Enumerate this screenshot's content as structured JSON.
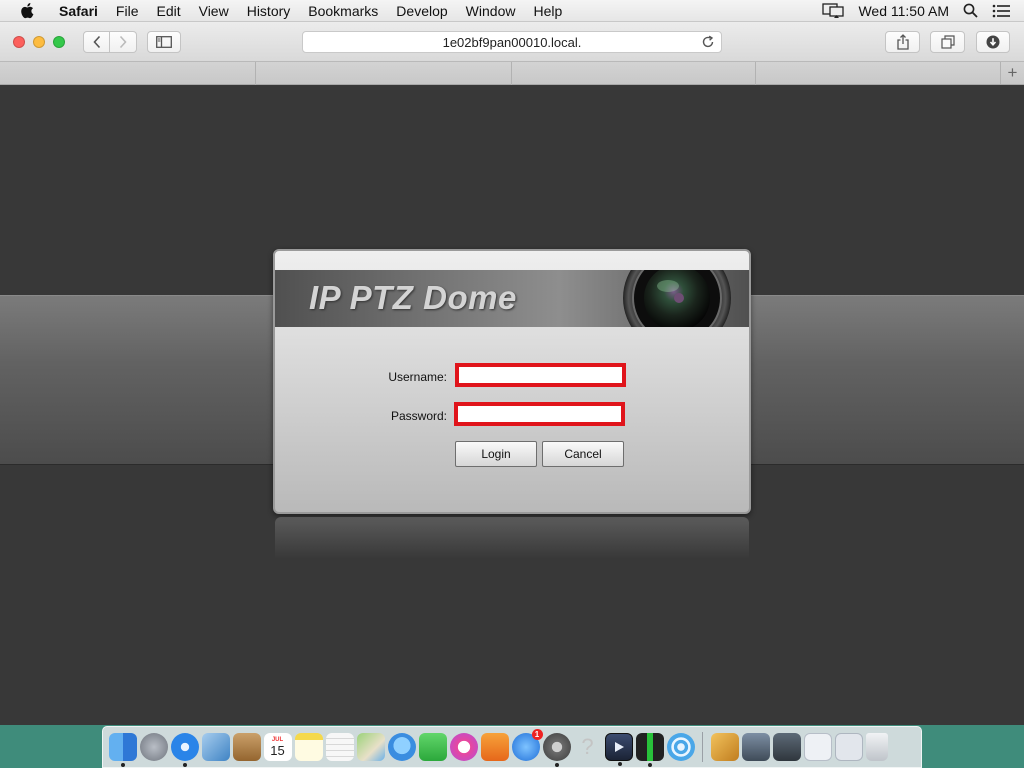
{
  "menubar": {
    "app_name": "Safari",
    "items": [
      "File",
      "Edit",
      "View",
      "History",
      "Bookmarks",
      "Develop",
      "Window",
      "Help"
    ],
    "clock": "Wed 11:50 AM",
    "icons": [
      "apple-icon",
      "airplay-icon",
      "spotlight-search-icon",
      "notification-center-icon"
    ]
  },
  "browser": {
    "address": "1e02bf9pan00010.local.",
    "traffic_colors": {
      "close": "#fc605c",
      "minimize": "#fdbc40",
      "zoom": "#34c84a"
    },
    "tab_count": 4
  },
  "login": {
    "banner_title": "IP PTZ Dome",
    "username_label": "Username:",
    "username_value": "",
    "password_label": "Password:",
    "password_value": "",
    "login_label": "Login",
    "cancel_label": "Cancel",
    "highlight_color": "#e0141b"
  },
  "dock": {
    "calendar_day": "15",
    "calendar_month": "JUL",
    "app_store_badge": "1",
    "apps": [
      {
        "name": "finder-icon",
        "color": "#3d8de0"
      },
      {
        "name": "launchpad-icon",
        "color": "#7a7f88"
      },
      {
        "name": "safari-icon",
        "color": "#2a84e8"
      },
      {
        "name": "preview-photos-icon",
        "color": "#5aa0d8"
      },
      {
        "name": "contacts-icon",
        "color": "#b8874a"
      },
      {
        "name": "calendar-icon",
        "color": "#ffffff"
      },
      {
        "name": "notes-icon",
        "color": "#f7e26b"
      },
      {
        "name": "reminders-icon",
        "color": "#f4f4f4"
      },
      {
        "name": "maps-icon",
        "color": "#8cc36d"
      },
      {
        "name": "messages-icon",
        "color": "#3fa3f5"
      },
      {
        "name": "facetime-icon",
        "color": "#3bc24c"
      },
      {
        "name": "itunes-icon",
        "color": "#e8479e"
      },
      {
        "name": "ibooks-icon",
        "color": "#f08a24"
      },
      {
        "name": "app-store-icon",
        "color": "#2f8ff0"
      },
      {
        "name": "system-preferences-icon",
        "color": "#7d7d7d"
      },
      {
        "name": "help-icon",
        "color": "#c9c9c9"
      },
      {
        "name": "quicktime-icon",
        "color": "#2c3a5a"
      },
      {
        "name": "terminal-icon",
        "color": "#2b2b2b"
      },
      {
        "name": "wifi-icon",
        "color": "#4aa7e8"
      }
    ],
    "docs": [
      {
        "name": "package-icon",
        "color": "#e0a63a"
      },
      {
        "name": "screen-sharing-icon",
        "color": "#5b6d80"
      },
      {
        "name": "network-icon",
        "color": "#48525e"
      },
      {
        "name": "document-stack-icon",
        "color": "#e4e8ee"
      },
      {
        "name": "downloads-stack-icon",
        "color": "#d6dbe2"
      },
      {
        "name": "trash-icon",
        "color": "#cfd3d8"
      }
    ]
  }
}
